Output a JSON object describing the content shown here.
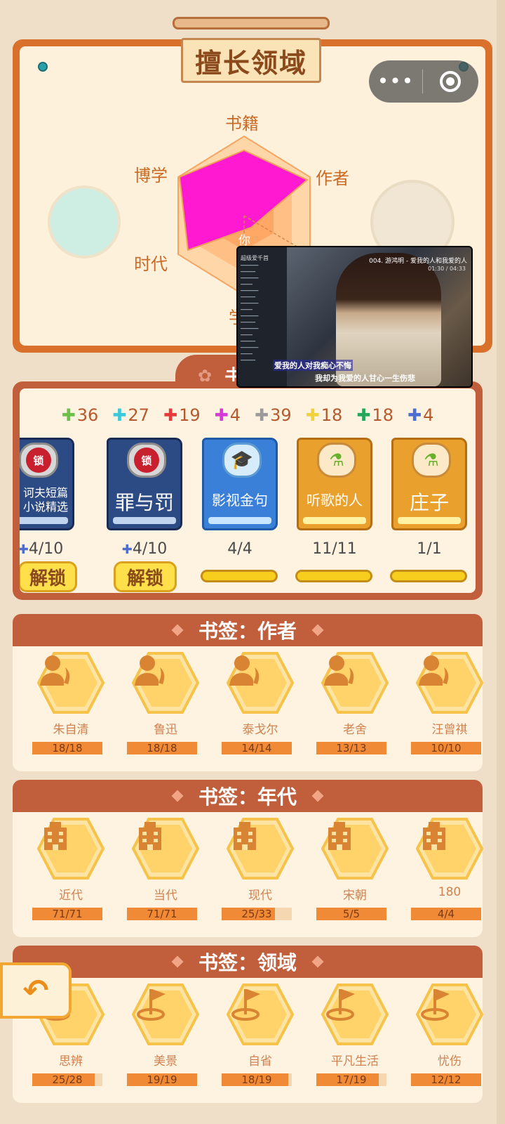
{
  "radar": {
    "title": "擅长领域",
    "axes": [
      "书籍",
      "作者",
      "学",
      "时代",
      "博学"
    ],
    "you_label": "你"
  },
  "capsule": {
    "more": "•••"
  },
  "video": {
    "song": "004. 游鸿明 - 爱我的人和我爱的人",
    "time": "01:30 / 04:33",
    "lyric1": "爱我的人对我痴心不悔",
    "lyric2": "我却为我爱的人甘心一生伤悲",
    "side_title": "超级爱千首"
  },
  "books_section": {
    "tab": "书",
    "pieces": [
      {
        "color": "#6cc04a",
        "count": "36"
      },
      {
        "color": "#3cc8d8",
        "count": "27"
      },
      {
        "color": "#e83a3a",
        "count": "19"
      },
      {
        "color": "#d63ad6",
        "count": "4"
      },
      {
        "color": "#9a9a9a",
        "count": "39"
      },
      {
        "color": "#f2d23a",
        "count": "18"
      },
      {
        "color": "#25a55a",
        "count": "18"
      },
      {
        "color": "#4d6ed1",
        "count": "4"
      }
    ],
    "books": [
      {
        "name": "诃夫短篇\n小说精选",
        "badge": "锁",
        "progress": "4/10",
        "action": "解锁"
      },
      {
        "name": "罪与罚",
        "badge": "锁",
        "progress": "4/10",
        "action": "解锁"
      },
      {
        "name": "影视金句",
        "progress": "4/4"
      },
      {
        "name": "听歌的人",
        "progress": "11/11"
      },
      {
        "name": "庄子",
        "progress": "1/1"
      }
    ]
  },
  "author_section": {
    "title": "书签：作者",
    "items": [
      {
        "name": "朱自清",
        "progress": "18/18",
        "ratio": 1
      },
      {
        "name": "鲁迅",
        "progress": "18/18",
        "ratio": 1
      },
      {
        "name": "泰戈尔",
        "progress": "14/14",
        "ratio": 1
      },
      {
        "name": "老舍",
        "progress": "13/13",
        "ratio": 1
      },
      {
        "name": "汪曾祺",
        "progress": "10/10",
        "ratio": 1
      }
    ]
  },
  "era_section": {
    "title": "书签：年代",
    "items": [
      {
        "name": "近代",
        "progress": "71/71",
        "ratio": 1
      },
      {
        "name": "当代",
        "progress": "71/71",
        "ratio": 1
      },
      {
        "name": "现代",
        "progress": "25/33",
        "ratio": 0.76
      },
      {
        "name": "宋朝",
        "progress": "5/5",
        "ratio": 1
      },
      {
        "name": "180",
        "progress": "4/4",
        "ratio": 1
      }
    ]
  },
  "field_section": {
    "title": "书签：领域",
    "items": [
      {
        "name": "思辨",
        "progress": "25/28",
        "ratio": 0.89
      },
      {
        "name": "美景",
        "progress": "19/19",
        "ratio": 1
      },
      {
        "name": "自省",
        "progress": "18/19",
        "ratio": 0.95
      },
      {
        "name": "平凡生活",
        "progress": "17/19",
        "ratio": 0.89
      },
      {
        "name": "忧伤",
        "progress": "12/12",
        "ratio": 1
      }
    ]
  },
  "back": {
    "icon": "back-arrow-icon"
  }
}
